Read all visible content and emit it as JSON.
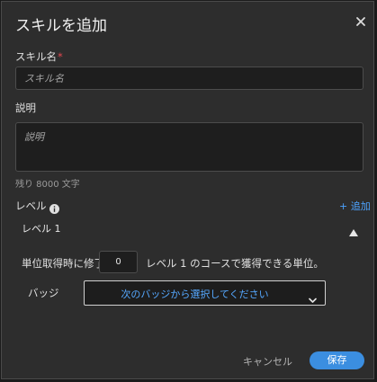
{
  "dialog": {
    "title": "スキルを追加",
    "close_icon": "close-icon"
  },
  "skill_name": {
    "label": "スキル名",
    "required_mark": "*",
    "value": "",
    "placeholder": "スキル名"
  },
  "description": {
    "label": "説明",
    "value": "",
    "placeholder": "説明",
    "remaining": "残り 8000 文字"
  },
  "levels": {
    "label": "レベル",
    "info_icon": "info-icon",
    "add_label": "+ 追加",
    "items": [
      {
        "name": "レベル 1",
        "units_label": "単位取得時に修了",
        "units_value": "0",
        "units_suffix": "レベル 1 のコースで獲得できる単位。",
        "badge_label": "バッジ",
        "badge_select": "次のバッジから選択してください"
      }
    ]
  },
  "footer": {
    "cancel_label": "キャンセル",
    "save_label": "保存"
  },
  "colors": {
    "accent": "#3b8ee0",
    "link": "#4da3ff",
    "required": "#e34850",
    "background": "#2d2d2d"
  }
}
